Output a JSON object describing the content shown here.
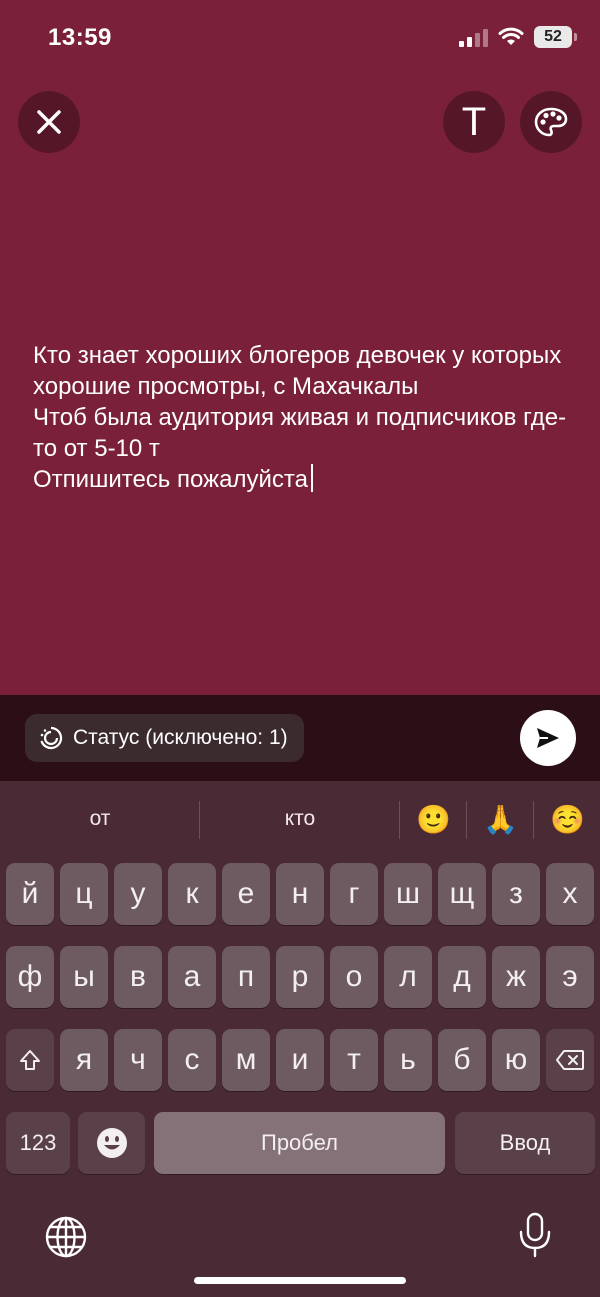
{
  "status_bar": {
    "time": "13:59",
    "battery": "52"
  },
  "top_controls": {
    "text_button_label": "T"
  },
  "story": {
    "text": "Кто знает хороших блогеров девочек у которых хорошие просмотры, с Махачкалы\nЧтоб была аудитория живая и подписчиков где-то от 5-10 т\nОтпишитесь пожалуйста"
  },
  "status_pill": {
    "label": "Статус (исключено: 1)"
  },
  "keyboard": {
    "suggestions": [
      "от",
      "кто"
    ],
    "emoji_suggestions": [
      "🙂",
      "🙏",
      "☺️"
    ],
    "row1": [
      "й",
      "ц",
      "у",
      "к",
      "е",
      "н",
      "г",
      "ш",
      "щ",
      "з",
      "х"
    ],
    "row2": [
      "ф",
      "ы",
      "в",
      "а",
      "п",
      "р",
      "о",
      "л",
      "д",
      "ж",
      "э"
    ],
    "row3": [
      "я",
      "ч",
      "с",
      "м",
      "и",
      "т",
      "ь",
      "б",
      "ю"
    ],
    "numbers_key": "123",
    "space_key": "Пробел",
    "return_key": "Ввод"
  },
  "colors": {
    "background": "#7a2139",
    "keyboard": "#4a2b35"
  }
}
